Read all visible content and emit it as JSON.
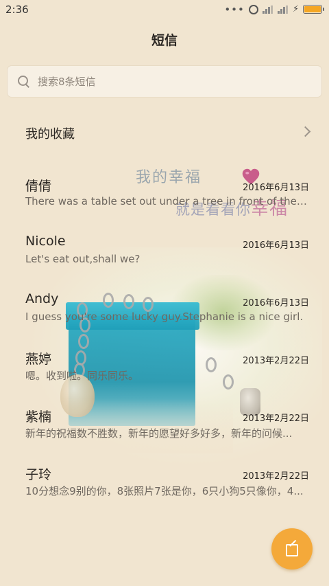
{
  "status_bar": {
    "time": "2:36",
    "icons": [
      "more-dots-icon",
      "alarm-icon",
      "signal-icon",
      "signal-icon",
      "charging-bolt-icon",
      "battery-icon"
    ],
    "battery_level": 1.0,
    "battery_color": "#f5a623"
  },
  "header": {
    "title": "短信"
  },
  "search": {
    "placeholder": "搜索8条短信"
  },
  "favorites": {
    "label": "我的收藏"
  },
  "wallpaper_text": {
    "line1": "我的幸福",
    "line2_prefix": "就是看看你",
    "line2_emphasis": "幸福"
  },
  "messages": [
    {
      "name": "倩倩",
      "date": "2016年6月13日",
      "preview": "There was a table set out under a tree in front of the ho..."
    },
    {
      "name": "Nicole",
      "date": "2016年6月13日",
      "preview": "Let's eat out,shall we?"
    },
    {
      "name": "Andy",
      "date": "2016年6月13日",
      "preview": "I guess you're some lucky guy.Stephanie is a nice girl."
    },
    {
      "name": "燕婷",
      "date": "2013年2月22日",
      "preview": "嗯。收到啦。同乐同乐。"
    },
    {
      "name": "紫楠",
      "date": "2013年2月22日",
      "preview": "新年的祝福数不胜数，新年的愿望好多好多，新年的问候..."
    },
    {
      "name": "子玲",
      "date": "2013年2月22日",
      "preview": "10分想念9别的你，8张照片7张是你，6只小狗5只像你，4..."
    }
  ],
  "colors": {
    "background": "#f1e5d0",
    "accent": "#f4a93a",
    "text_primary": "#2b2723",
    "text_secondary": "#6f6860"
  },
  "fab": {
    "icon": "compose-icon"
  }
}
